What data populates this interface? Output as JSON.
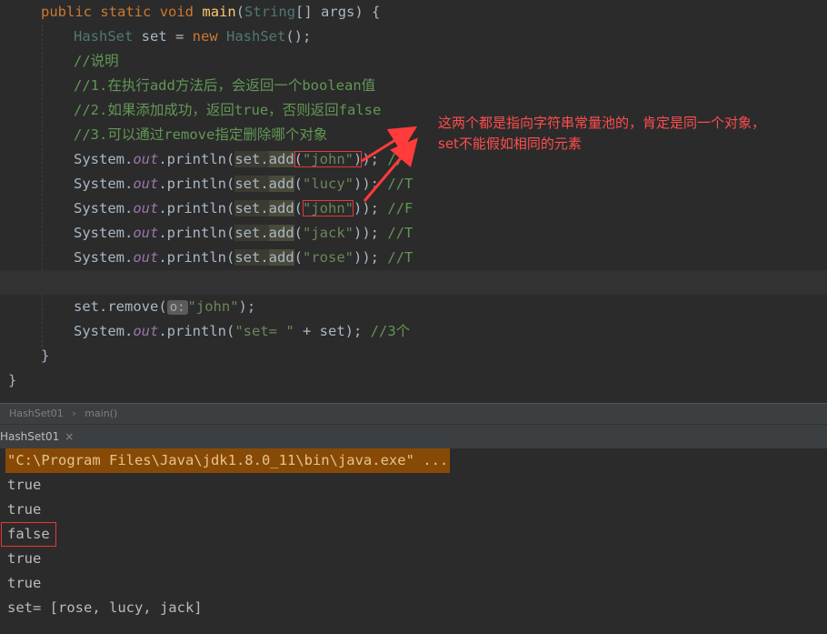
{
  "editor": {
    "lines": [
      {
        "parts": [
          "public",
          "static",
          "void",
          "main",
          "(",
          "String",
          "[] args) {"
        ]
      },
      {
        "parts": [
          "HashSet",
          "set = ",
          "new",
          "HashSet",
          "();"
        ]
      },
      {
        "text": "//说明"
      },
      {
        "text": "//1.在执行add方法后，会返回一个boolean值"
      },
      {
        "text": "//2.如果添加成功，返回true，否则返回false"
      },
      {
        "text": "//3.可以通过remove指定删除哪个对象"
      },
      {
        "arg": "\"john\"",
        "tail": "//T"
      },
      {
        "arg": "\"lucy\"",
        "tail": "//T"
      },
      {
        "arg": "\"john\"",
        "tail": "//F"
      },
      {
        "arg": "\"jack\"",
        "tail": "//T"
      },
      {
        "arg": "\"rose\"",
        "tail": "//T"
      },
      {
        "remove": {
          "obj": "set",
          "method": "remove",
          "hint": "o:",
          "arg": "\"john\""
        }
      },
      {
        "println2": {
          "str": "\"set= \"",
          "rest": " + set); ",
          "comment": "//3个"
        }
      }
    ],
    "sysout": {
      "cls": "System.",
      "field": "out",
      "method": ".println(",
      "set": "set.",
      "add": "add",
      "close": ");"
    },
    "brace_close": "}",
    "class_close": "}"
  },
  "annotation": {
    "line1": "这两个都是指向字符串常量池的，肯定是同一个对象，",
    "line2": "set不能假如相同的元素",
    "color": "#ff4d4d"
  },
  "breadcrumb": {
    "items": [
      "HashSet01",
      "main()"
    ],
    "separator": "›"
  },
  "run_tab": {
    "label": "HashSet01",
    "close": "×"
  },
  "console": {
    "command": "\"C:\\Program Files\\Java\\jdk1.8.0_11\\bin\\java.exe\" ...",
    "outputs": [
      "true",
      "true",
      "false",
      "true",
      "true",
      "set= [rose, lucy, jack]"
    ]
  }
}
